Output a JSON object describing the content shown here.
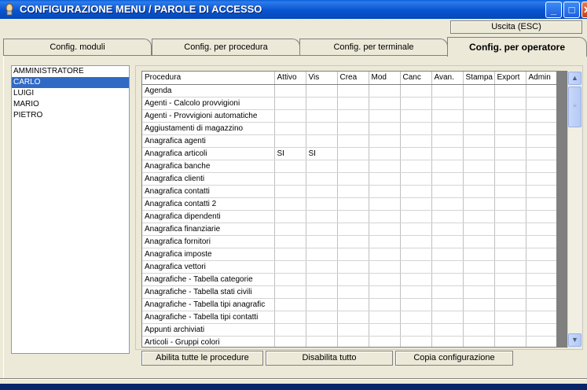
{
  "window": {
    "title": "CONFIGURAZIONE MENU / PAROLE DI ACCESSO",
    "minimize_label": "_",
    "maximize_label": "□",
    "close_label": "✕"
  },
  "exit_button": "Uscita (ESC)",
  "tabs": [
    {
      "label": "Config. moduli"
    },
    {
      "label": "Config. per procedura"
    },
    {
      "label": "Config. per terminale"
    },
    {
      "label": "Config. per operatore"
    }
  ],
  "operators": [
    {
      "label": "AMMINISTRATORE"
    },
    {
      "label": "CARLO"
    },
    {
      "label": "LUIGI"
    },
    {
      "label": "MARIO"
    },
    {
      "label": "PIETRO"
    }
  ],
  "selected_operator": "CARLO",
  "grid": {
    "columns": [
      "Procedura",
      "Attivo",
      "Vis",
      "Crea",
      "Mod",
      "Canc",
      "Avan.",
      "Stampa",
      "Export",
      "Admin"
    ],
    "rows": [
      [
        "Agenda",
        "",
        "",
        "",
        "",
        "",
        "",
        "",
        "",
        ""
      ],
      [
        "Agenti - Calcolo provvigioni",
        "",
        "",
        "",
        "",
        "",
        "",
        "",
        "",
        ""
      ],
      [
        "Agenti - Provvigioni automatiche",
        "",
        "",
        "",
        "",
        "",
        "",
        "",
        "",
        ""
      ],
      [
        "Aggiustamenti di magazzino",
        "",
        "",
        "",
        "",
        "",
        "",
        "",
        "",
        ""
      ],
      [
        "Anagrafica agenti",
        "",
        "",
        "",
        "",
        "",
        "",
        "",
        "",
        ""
      ],
      [
        "Anagrafica articoli",
        "SI",
        "SI",
        "",
        "",
        "",
        "",
        "",
        "",
        ""
      ],
      [
        "Anagrafica banche",
        "",
        "",
        "",
        "",
        "",
        "",
        "",
        "",
        ""
      ],
      [
        "Anagrafica clienti",
        "",
        "",
        "",
        "",
        "",
        "",
        "",
        "",
        ""
      ],
      [
        "Anagrafica contatti",
        "",
        "",
        "",
        "",
        "",
        "",
        "",
        "",
        ""
      ],
      [
        "Anagrafica contatti 2",
        "",
        "",
        "",
        "",
        "",
        "",
        "",
        "",
        ""
      ],
      [
        "Anagrafica dipendenti",
        "",
        "",
        "",
        "",
        "",
        "",
        "",
        "",
        ""
      ],
      [
        "Anagrafica finanziarie",
        "",
        "",
        "",
        "",
        "",
        "",
        "",
        "",
        ""
      ],
      [
        "Anagrafica fornitori",
        "",
        "",
        "",
        "",
        "",
        "",
        "",
        "",
        ""
      ],
      [
        "Anagrafica imposte",
        "",
        "",
        "",
        "",
        "",
        "",
        "",
        "",
        ""
      ],
      [
        "Anagrafica vettori",
        "",
        "",
        "",
        "",
        "",
        "",
        "",
        "",
        ""
      ],
      [
        "Anagrafiche - Tabella categorie",
        "",
        "",
        "",
        "",
        "",
        "",
        "",
        "",
        ""
      ],
      [
        "Anagrafiche - Tabella stati civili",
        "",
        "",
        "",
        "",
        "",
        "",
        "",
        "",
        ""
      ],
      [
        "Anagrafiche - Tabella tipi anagrafic",
        "",
        "",
        "",
        "",
        "",
        "",
        "",
        "",
        ""
      ],
      [
        "Anagrafiche - Tabella tipi contatti",
        "",
        "",
        "",
        "",
        "",
        "",
        "",
        "",
        ""
      ],
      [
        "Appunti archiviati",
        "",
        "",
        "",
        "",
        "",
        "",
        "",
        "",
        ""
      ],
      [
        "Articoli - Gruppi colori",
        "",
        "",
        "",
        "",
        "",
        "",
        "",
        "",
        ""
      ]
    ]
  },
  "buttons": {
    "enable_all": "Abilita tutte le procedure",
    "disable_all": "Disabilita tutto",
    "copy_config": "Copia configurazione"
  },
  "scrollbar": {
    "up_icon": "▲",
    "down_icon": "▼",
    "thumb_grip": "≡"
  }
}
